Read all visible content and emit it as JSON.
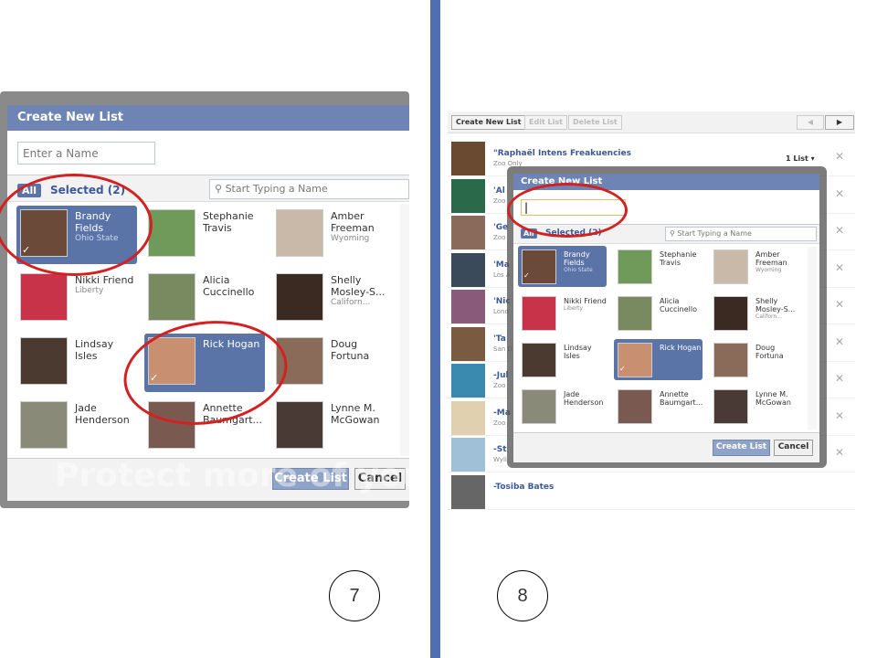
{
  "dialog": {
    "title": "Create New List",
    "name_placeholder": "Enter a Name",
    "tab_all": "All",
    "tab_selected": "Selected (2)",
    "search_placeholder": "Start Typing a Name",
    "create_label": "Create List",
    "cancel_label": "Cancel"
  },
  "friends": [
    {
      "name": "Brandy Fields",
      "sub": "Ohio State",
      "selected": true,
      "color": "#6b4a3a"
    },
    {
      "name": "Stephanie Travis",
      "sub": "",
      "selected": false,
      "color": "#6f9a5a"
    },
    {
      "name": "Amber Freeman",
      "sub": "Wyoming",
      "selected": false,
      "color": "#c8b9a8"
    },
    {
      "name": "Nikki Friend",
      "sub": "Liberty",
      "selected": false,
      "color": "#c8334a"
    },
    {
      "name": "Alicia Cuccinello",
      "sub": "",
      "selected": false,
      "color": "#7a8a60"
    },
    {
      "name": "Shelly Mosley-S...",
      "sub": "Californ...",
      "selected": false,
      "color": "#3a2a22"
    },
    {
      "name": "Lindsay Isles",
      "sub": "",
      "selected": false,
      "color": "#4a3a30"
    },
    {
      "name": "Rick Hogan",
      "sub": "",
      "selected": true,
      "color": "#c89070"
    },
    {
      "name": "Doug Fortuna",
      "sub": "",
      "selected": false,
      "color": "#8a6a58"
    },
    {
      "name": "Jade Henderson",
      "sub": "",
      "selected": false,
      "color": "#8a8a78"
    },
    {
      "name": "Annette Baumgart...",
      "sub": "",
      "selected": false,
      "color": "#7a5a50"
    },
    {
      "name": "Lynne M. McGowan",
      "sub": "",
      "selected": false,
      "color": "#4a3a36"
    }
  ],
  "toolbar": {
    "create": "Create New List",
    "edit": "Edit List",
    "delete": "Delete List"
  },
  "rows": [
    {
      "name": "\"Raphaël Intens Freakuencies",
      "sub": "Zoo Only",
      "lists": "1 List",
      "color": "#6a4a30"
    },
    {
      "name": "'Al",
      "sub": "Zoo",
      "color": "#2a6a4a"
    },
    {
      "name": "'Ge",
      "sub": "Zoo",
      "color": "#8a6a5a"
    },
    {
      "name": "'Ma",
      "sub": "Los A",
      "color": "#3a4a5a"
    },
    {
      "name": "'Nic",
      "sub": "Lond",
      "color": "#8a5a7a"
    },
    {
      "name": "'Ta",
      "sub": "San D",
      "color": "#7a5a40"
    },
    {
      "name": "-Jul",
      "sub": "Zoo",
      "color": "#3a8ab0"
    },
    {
      "name": "-Ma",
      "sub": "Zoo",
      "color": "#e0d0b0"
    },
    {
      "name": "-St",
      "sub": "Wyli",
      "color": "#a0c0d8"
    },
    {
      "name": "-Tosiba Bates",
      "sub": "",
      "color": "#666"
    }
  ],
  "watermark": "Protect more of your memories for less!",
  "steps": [
    "7",
    "8"
  ]
}
